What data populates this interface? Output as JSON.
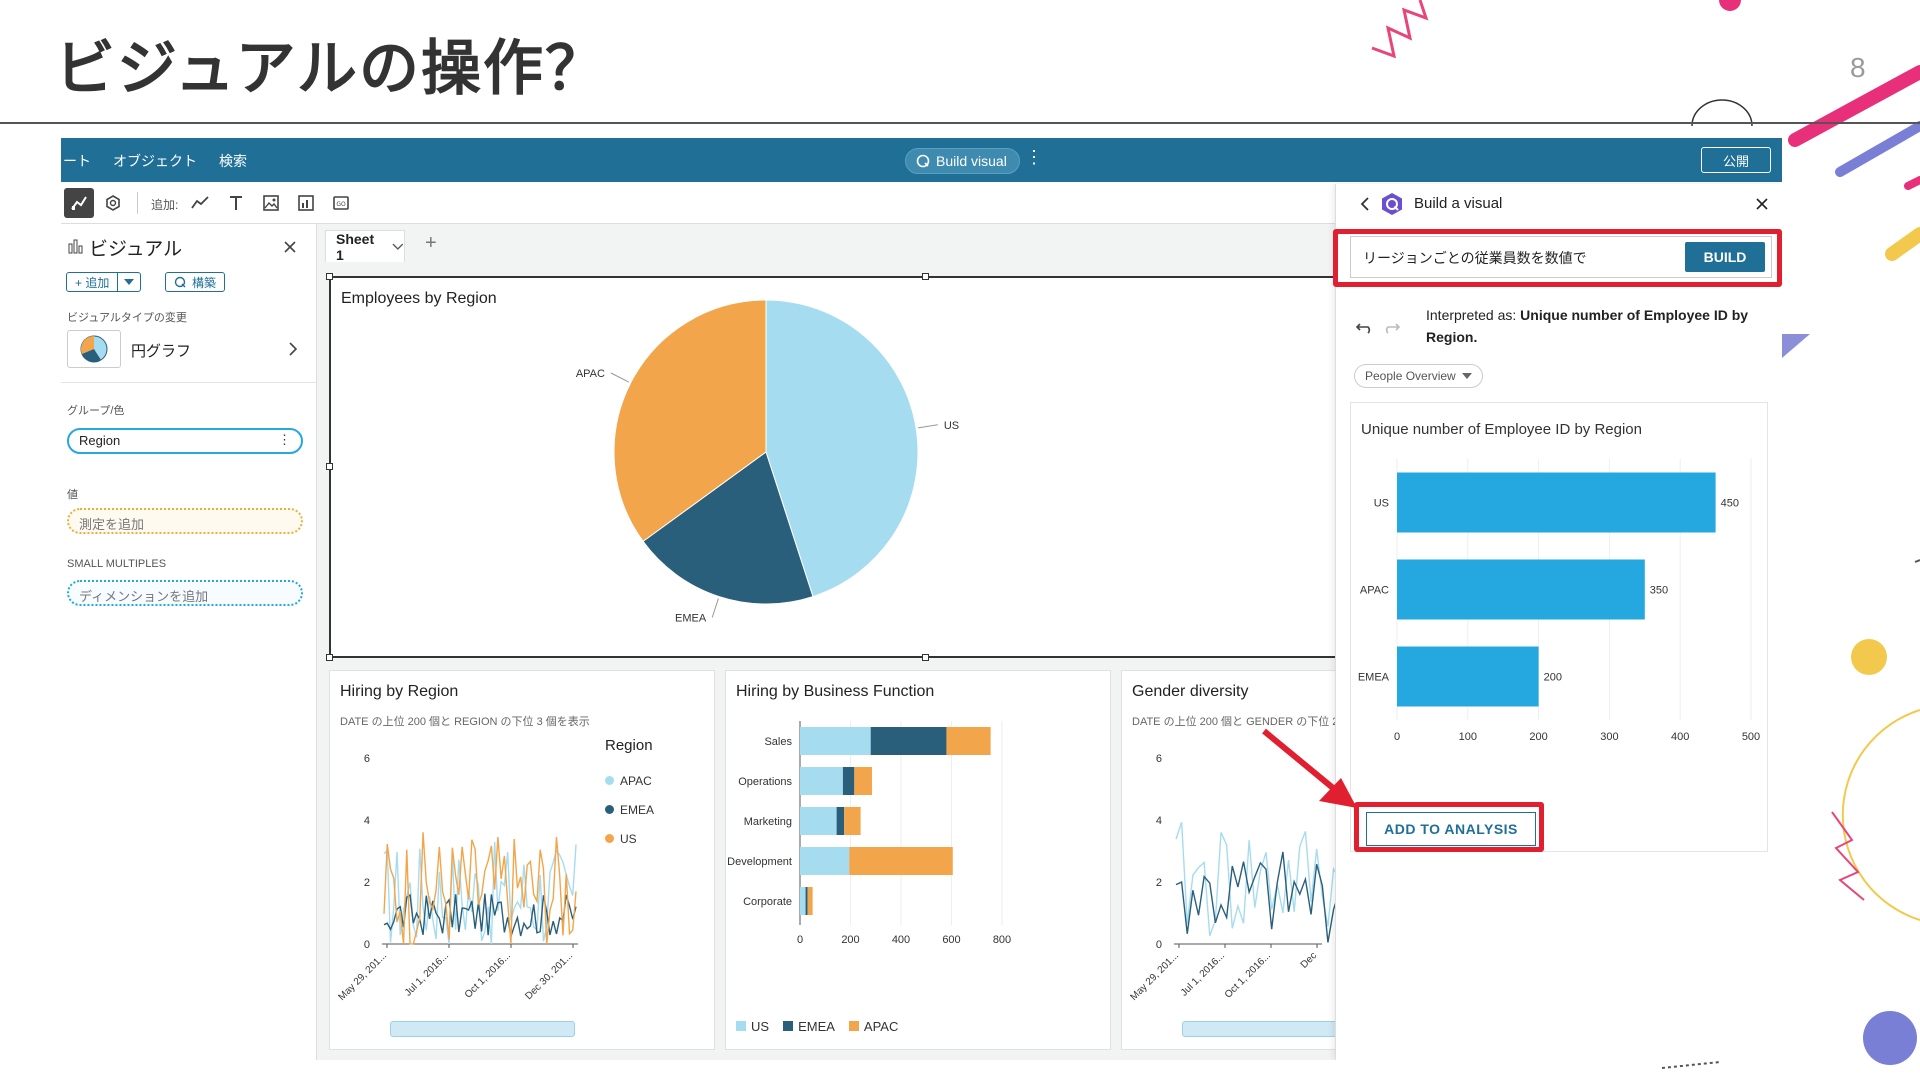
{
  "slide": {
    "title": "ビジュアルの操作？",
    "page_number": "8"
  },
  "topbar": {
    "menu_items": [
      "ート",
      "オブジェクト",
      "検索"
    ],
    "build_visual_label": "Build visual",
    "more_label": "⋮",
    "publish_label": "公開"
  },
  "toolbar": {
    "add_label": "追加:"
  },
  "left_panel": {
    "title": "ビジュアル",
    "add_button": "+ 追加",
    "build_button": "構築",
    "visual_type_label": "ビジュアルタイプの変更",
    "visual_type_value": "円グラフ",
    "group_color_label": "グループ/色",
    "group_field": "Region",
    "value_label": "値",
    "value_placeholder": "測定を追加",
    "small_multiples_label": "SMALL MULTIPLES",
    "small_multiples_placeholder": "ディメンションを追加"
  },
  "sheet_tabs": {
    "active_tab": "Sheet 1",
    "add_tab": "+"
  },
  "colors": {
    "light_blue": "#a5dcef",
    "dark_teal": "#2a5f7c",
    "orange": "#f2a54a",
    "bar_blue": "#25a8e0",
    "header_blue": "#1f6f97",
    "highlight_red": "#e02030"
  },
  "pie_card": {
    "title": "Employees by Region",
    "chart_data": {
      "type": "pie",
      "categories": [
        "US",
        "EMEA",
        "APAC"
      ],
      "values": [
        450,
        200,
        350
      ],
      "labels": [
        "US",
        "EMEA",
        "APAC"
      ]
    }
  },
  "hiring_region_card": {
    "title": "Hiring by Region",
    "subtitle": "DATE の上位 200 個と REGION の下位 3 個を表示",
    "legend_title": "Region",
    "legend": [
      "APAC",
      "EMEA",
      "US"
    ],
    "chart_data": {
      "type": "line",
      "series": [
        {
          "name": "APAC",
          "values": []
        },
        {
          "name": "EMEA",
          "values": []
        },
        {
          "name": "US",
          "values": []
        }
      ],
      "x_ticks": [
        "May 29, 201...",
        "Jul 1, 2016...",
        "Oct 1, 2016...",
        "Dec 30, 201..."
      ],
      "y_ticks": [
        "0",
        "2",
        "4",
        "6"
      ],
      "ylim": [
        0,
        6
      ]
    }
  },
  "hiring_function_card": {
    "title": "Hiring by Business Function",
    "legend": [
      "US",
      "EMEA",
      "APAC"
    ],
    "chart_data": {
      "type": "bar",
      "orientation": "horizontal",
      "stacked": true,
      "categories": [
        "Sales",
        "Operations",
        "Marketing",
        "Development",
        "Corporate"
      ],
      "series": [
        {
          "name": "US",
          "values": [
            280,
            170,
            145,
            195,
            22
          ]
        },
        {
          "name": "EMEA",
          "values": [
            300,
            45,
            30,
            0,
            8
          ]
        },
        {
          "name": "APAC",
          "values": [
            175,
            70,
            65,
            410,
            20
          ]
        }
      ],
      "x_ticks": [
        "0",
        "200",
        "400",
        "600",
        "800"
      ],
      "xlim": [
        0,
        800
      ]
    }
  },
  "gender_card": {
    "title": "Gender diversity",
    "subtitle": "DATE の上位 200 個と GENDER の下位 2",
    "chart_data": {
      "type": "line",
      "x_ticks": [
        "May 29, 201...",
        "Jul 1, 2016...",
        "Oct 1, 2016...",
        "Dec"
      ],
      "y_ticks": [
        "0",
        "2",
        "4",
        "6"
      ],
      "ylim": [
        0,
        6
      ]
    }
  },
  "build_panel": {
    "title": "Build a visual",
    "query_value": "リージョンごとの従業員数を数値で",
    "build_button": "BUILD",
    "interpreted_prefix": "Interpreted as: ",
    "interpreted_bold": "Unique number of Employee ID by Region.",
    "dataset_dropdown": "People Overview",
    "preview_title": "Unique number of Employee ID by Region",
    "add_to_analysis": "ADD TO ANALYSIS",
    "chart_data": {
      "type": "bar",
      "orientation": "horizontal",
      "categories": [
        "US",
        "APAC",
        "EMEA"
      ],
      "values": [
        450,
        350,
        200
      ],
      "data_labels": [
        "450",
        "350",
        "200"
      ],
      "x_ticks": [
        "0",
        "100",
        "200",
        "300",
        "400",
        "500"
      ],
      "xlim": [
        0,
        500
      ]
    }
  }
}
